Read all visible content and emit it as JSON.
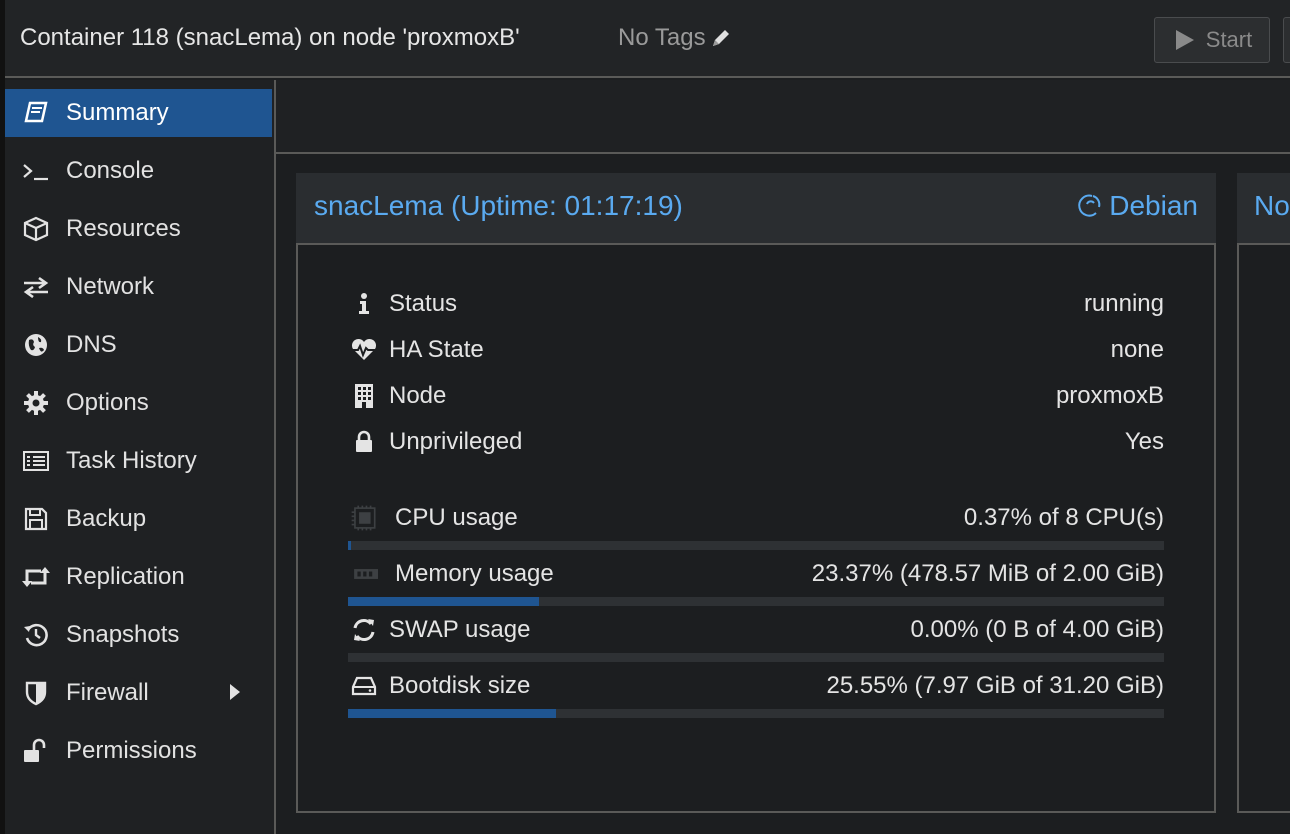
{
  "header": {
    "title": "Container 118 (snacLema) on node 'proxmoxB'",
    "tags_label": "No Tags",
    "start_label": "Start"
  },
  "sidebar": {
    "items": [
      {
        "label": "Summary",
        "icon": "book-icon",
        "active": true
      },
      {
        "label": "Console",
        "icon": "terminal-icon"
      },
      {
        "label": "Resources",
        "icon": "cube-icon"
      },
      {
        "label": "Network",
        "icon": "exchange-icon"
      },
      {
        "label": "DNS",
        "icon": "globe-icon"
      },
      {
        "label": "Options",
        "icon": "gear-icon"
      },
      {
        "label": "Task History",
        "icon": "list-icon"
      },
      {
        "label": "Backup",
        "icon": "floppy-icon"
      },
      {
        "label": "Replication",
        "icon": "retweet-icon"
      },
      {
        "label": "Snapshots",
        "icon": "history-icon"
      },
      {
        "label": "Firewall",
        "icon": "shield-icon"
      },
      {
        "label": "Permissions",
        "icon": "unlock-icon"
      }
    ]
  },
  "summary": {
    "title": "snacLema (Uptime: 01:17:19)",
    "os": "Debian",
    "second_panel_title": "No",
    "status": [
      {
        "label": "Status",
        "value": "running",
        "icon": "info-icon"
      },
      {
        "label": "HA State",
        "value": "none",
        "icon": "heartbeat-icon"
      },
      {
        "label": "Node",
        "value": "proxmoxB",
        "icon": "building-icon"
      },
      {
        "label": "Unprivileged",
        "value": "Yes",
        "icon": "lock-icon"
      }
    ],
    "usage": [
      {
        "label": "CPU usage",
        "value": "0.37% of 8 CPU(s)",
        "icon": "cpu-icon",
        "fraction": 0.0037
      },
      {
        "label": "Memory usage",
        "value": "23.37% (478.57 MiB of 2.00 GiB)",
        "icon": "memory-icon",
        "fraction": 0.2337
      },
      {
        "label": "SWAP usage",
        "value": "0.00% (0 B of 4.00 GiB)",
        "icon": "refresh-icon",
        "fraction": 0.0
      },
      {
        "label": "Bootdisk size",
        "value": "25.55% (7.97 GiB of 31.20 GiB)",
        "icon": "hdd-icon",
        "fraction": 0.2555
      }
    ]
  },
  "colors": {
    "accent": "#1f5591",
    "link": "#5aaaf0",
    "background": "#1c1e20"
  }
}
